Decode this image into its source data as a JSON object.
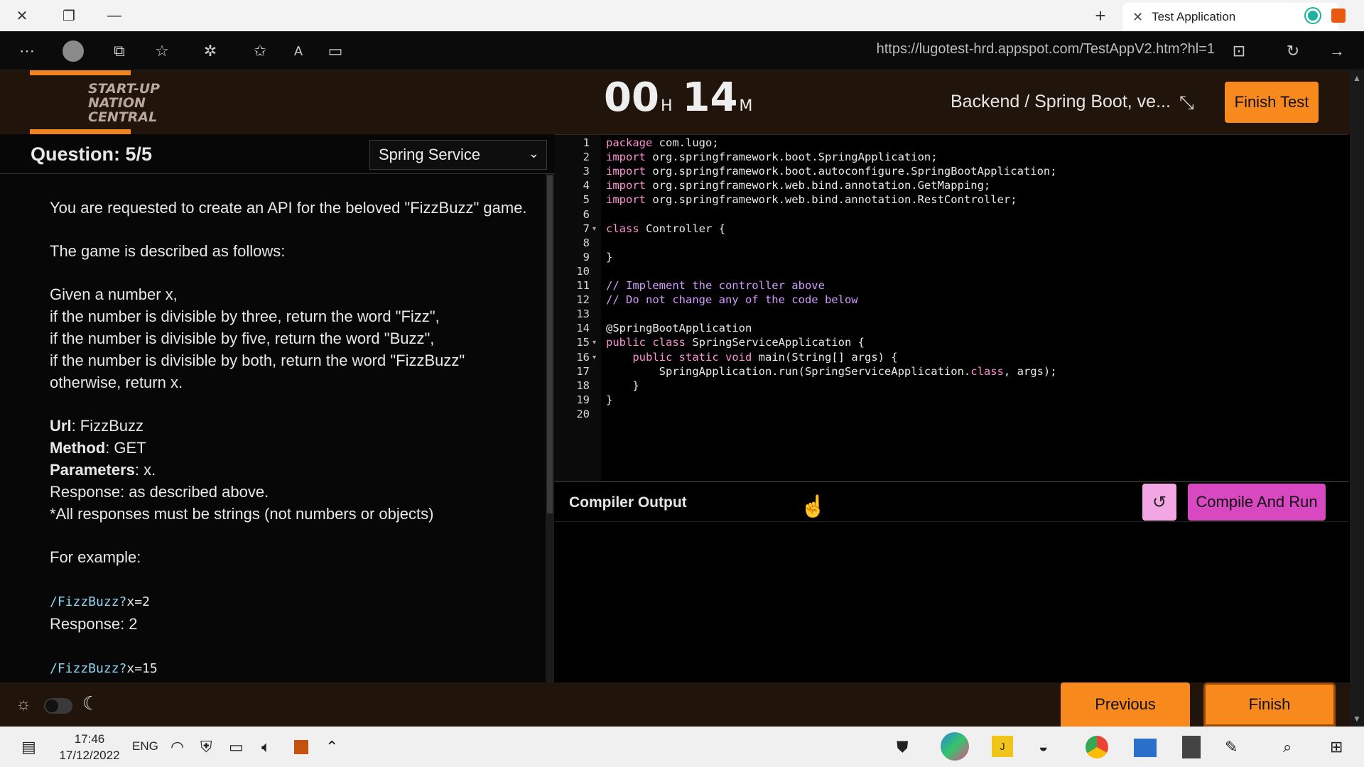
{
  "browser": {
    "tab_title": "Test Application",
    "url": "https://lugotest-hrd.appspot.com/TestAppV2.htm?hl=1"
  },
  "header": {
    "logo_text": [
      "START-UP",
      "NATION",
      "CENTRAL"
    ],
    "timer_hours": "00",
    "timer_hours_unit": "H",
    "timer_minutes": "14",
    "timer_minutes_unit": "M",
    "breadcrumb": "Backend / Spring Boot, ve...",
    "finish_test_label": "Finish Test"
  },
  "question": {
    "title": "Question: 5/5",
    "language_select": "Spring Service",
    "intro": "You are requested to create an API for the beloved \"FizzBuzz\" game.",
    "game_desc": "The game is described as follows:",
    "rules": [
      "Given a number x,",
      "if the number is divisible by three, return the word \"Fizz\",",
      "if the number is divisible by five, return the word \"Buzz\",",
      "if the number is divisible by both, return the word \"FizzBuzz\"",
      "otherwise, return x."
    ],
    "url_label": "Url",
    "url_value": ": FizzBuzz",
    "method_label": "Method",
    "method_value": ": GET",
    "params_label": "Parameters",
    "params_value": ": x.",
    "response_line": "Response: as described above.",
    "strings_note": "*All responses must be strings (not numbers or objects)",
    "example_heading": "For example:",
    "example1_path": "/FizzBuzz?",
    "example1_query": "x=2",
    "example1_response": "Response: 2",
    "example2_path": "/FizzBuzz?",
    "example2_query": "x=15"
  },
  "editor": {
    "lines": [
      "package com.lugo;",
      "import org.springframework.boot.SpringApplication;",
      "import org.springframework.boot.autoconfigure.SpringBootApplication;",
      "import org.springframework.web.bind.annotation.GetMapping;",
      "import org.springframework.web.bind.annotation.RestController;",
      "",
      "class Controller {",
      "",
      "}",
      "",
      "// Implement the controller above",
      "// Do not change any of the code below",
      "",
      "@SpringBootApplication",
      "public class SpringServiceApplication {",
      "    public static void main(String[] args) {",
      "        SpringApplication.run(SpringServiceApplication.class, args);",
      "    }",
      "}",
      ""
    ]
  },
  "output": {
    "title": "Compiler Output",
    "run_label": "Compile And Run"
  },
  "footer": {
    "previous_label": "Previous",
    "finish_label": "Finish"
  },
  "taskbar": {
    "time": "17:46",
    "date": "17/12/2022",
    "language": "ENG"
  },
  "colors": {
    "accent_orange": "#f7891d",
    "run_pink": "#d848c1",
    "header_brown": "#21140b"
  }
}
